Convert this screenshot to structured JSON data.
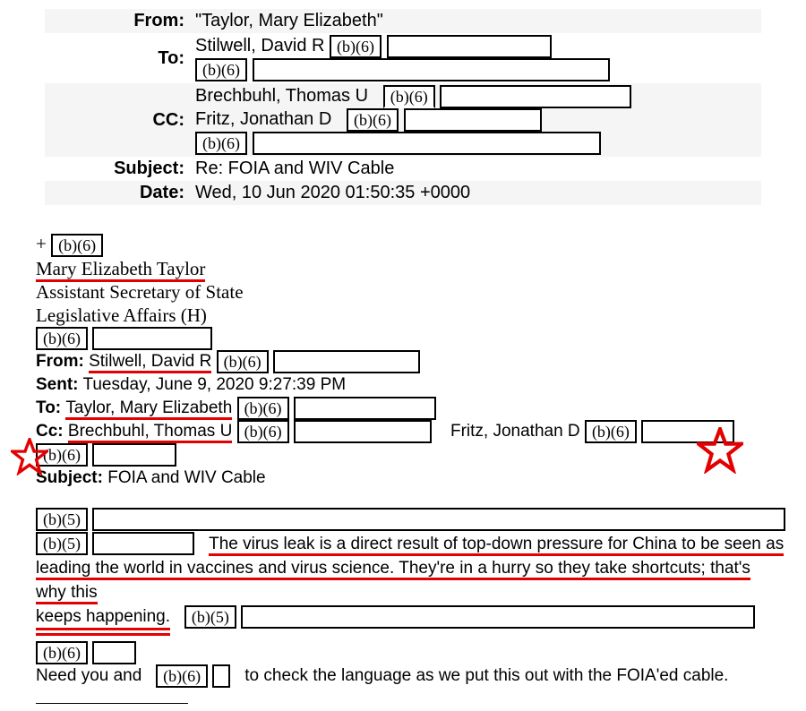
{
  "header": {
    "from_label": "From:",
    "from_value": "\"Taylor, Mary Elizabeth\"",
    "to_label": "To:",
    "to_line1_name": "Stilwell, David R",
    "cc_label": "CC:",
    "cc_line1_name": "Brechbuhl, Thomas U",
    "cc_line2_name": "Fritz, Jonathan D",
    "subject_label": "Subject:",
    "subject_value": "Re: FOIA and WIV Cable",
    "date_label": "Date:",
    "date_value": "Wed, 10 Jun 2020 01:50:35 +0000"
  },
  "exempt": {
    "b6": "(b)(6)",
    "b5": "(b)(5)"
  },
  "sig": {
    "plus": "+",
    "name": "Mary Elizabeth Taylor",
    "title": "Assistant Secretary of State",
    "office": "Legislative Affairs (H)"
  },
  "quoted": {
    "from_label": "From:",
    "from_name": "Stilwell, David R",
    "sent_label": "Sent:",
    "sent_value": "Tuesday, June 9, 2020 9:27:39 PM",
    "to_label": "To:",
    "to_name": "Taylor, Mary Elizabeth",
    "cc_label": "Cc:",
    "cc_name1": "Brechbuhl, Thomas U",
    "cc_name2": "Fritz, Jonathan D",
    "subject_label": "Subject:",
    "subject_value": "FOIA and WIV Cable"
  },
  "body": {
    "para1a": "The virus leak is a direct result of top-down pressure for China to be seen as",
    "para1b": "leading the world in vaccines and virus science.  ",
    "para1c": "They're in a hurry so they take shortcuts; that's why this",
    "para1d": "keeps happening.",
    "need1": "Need you and",
    "need2": "to check the language as we put this out with the FOIA'ed cable."
  }
}
